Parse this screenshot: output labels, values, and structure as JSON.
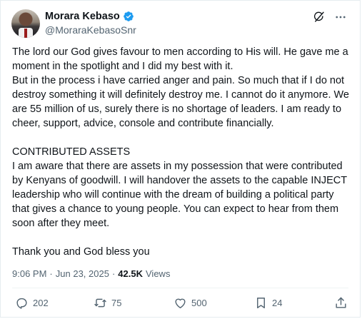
{
  "author": {
    "display_name": "Morara Kebaso",
    "handle": "@MoraraKebasoSnr",
    "verified_color": "#1d9bf0"
  },
  "icons": {
    "grok": "grok-icon",
    "more": "more-icon",
    "reply": "reply-icon",
    "repost": "repost-icon",
    "like": "heart-icon",
    "bookmark": "bookmark-icon",
    "share": "share-icon"
  },
  "tweet": {
    "text": "The lord our God gives favour to men according to His will. He gave me a moment in the spotlight and I did my best with it.\nBut in the process i have carried anger and pain. So much that if I do not destroy something it will definitely destroy me. I cannot do it anymore. We are 55 million of us, surely there is no shortage of leaders. I am ready to cheer, support, advice, console and contribute financially.\n\nCONTRIBUTED ASSETS\nI am aware that there are assets in my possession that were contributed by Kenyans of goodwill. I will handover the assets to the capable INJECT leadership who will continue with the dream of building a political party that gives a chance to young people. You can expect to hear from them soon after they meet.\n\nThank you and God bless you"
  },
  "meta": {
    "time": "9:06 PM",
    "separator1": "·",
    "date": "Jun 23, 2025",
    "separator2": "·",
    "views_count": "42.5K",
    "views_label": "Views"
  },
  "actions": {
    "replies": "202",
    "reposts": "75",
    "likes": "500",
    "bookmarks": "24"
  }
}
